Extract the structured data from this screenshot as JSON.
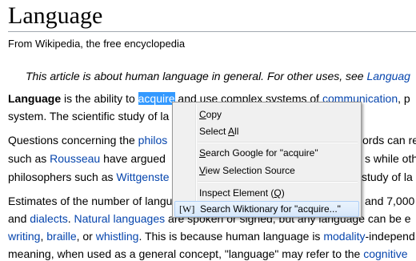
{
  "article": {
    "title": "Language",
    "tagline": "From Wikipedia, the free encyclopedia",
    "hatnote": "This article is about human language in general. For other uses, see ",
    "hatnote_link": "Languag",
    "p1": {
      "bold": "Language",
      "t1": " is the ability to ",
      "selected": "acquire",
      "t2": " and use complex systems of ",
      "link1": "communication",
      "t3": ", p",
      "line2": "system. The scientific study of la"
    },
    "p2": {
      "a1": "Questions concerning the ",
      "a1_link": "philos",
      "a2": "ords can re",
      "b1": "such as ",
      "b1_link": "Rousseau",
      "b2": " have argued",
      "b3": "s while oth",
      "c1": "philosophers such as ",
      "c1_link": "Wittgenste",
      "c2": " study of la"
    },
    "p3": {
      "a1": "Estimates of the number of langu",
      "a2": " and 7,000",
      "b1": "and ",
      "b1_link": "dialects",
      "b2": ". ",
      "b2_link": "Natural languages",
      "b3": " are spoken or signed, but any language can be e",
      "c1_link": "writing",
      "c2": ", ",
      "c2_link": "braille",
      "c3": ", or ",
      "c3_link": "whistling",
      "c4": ". This is because human language is ",
      "c4_link": "modality",
      "c5": "-independ",
      "d1": "meaning, when used as a general concept, \"language\" may refer to the ",
      "d1_link": "cognitive"
    }
  },
  "context_menu": {
    "items": [
      {
        "id": "copy",
        "before": "",
        "key": "C",
        "after": "opy"
      },
      {
        "id": "select-all",
        "before": "Select ",
        "key": "A",
        "after": "ll"
      },
      {
        "id": "search-google",
        "before": "",
        "key": "S",
        "after": "earch Google for \"acquire\""
      },
      {
        "id": "view-selection-source",
        "before": "",
        "key": "V",
        "after": "iew Selection Source"
      },
      {
        "id": "inspect-element",
        "before": "Inspect Element (",
        "key": "Q",
        "after": ")"
      },
      {
        "id": "search-wiktionary",
        "before": "Search Wiktionary for \"acquire...\"",
        "key": "",
        "after": ""
      }
    ],
    "wiktionary_icon_text": "[W]",
    "hovered_item": "search-wiktionary"
  },
  "colors": {
    "link": "#0645ad",
    "selection": "#3399ff",
    "menu_bg": "#f0f0f0",
    "menu_hover": "#d7e8fb"
  }
}
